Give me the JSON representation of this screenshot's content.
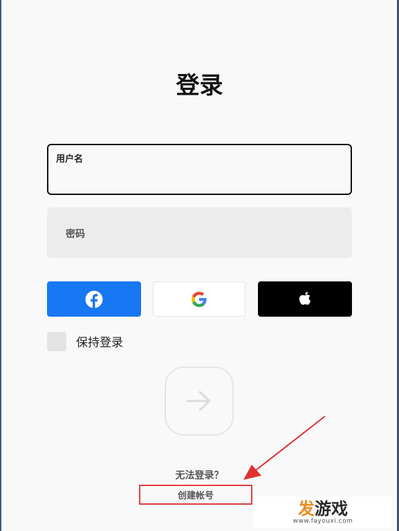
{
  "login": {
    "title": "登录",
    "username_label": "用户名",
    "username_value": "",
    "password_label": "密码",
    "social": [
      {
        "name": "facebook",
        "icon": "facebook-icon",
        "color": "#1877f2"
      },
      {
        "name": "google",
        "icon": "google-icon",
        "color": "#ffffff"
      },
      {
        "name": "apple",
        "icon": "apple-icon",
        "color": "#000000"
      }
    ],
    "remember_label": "保持登录",
    "remember_checked": false,
    "submit_icon": "arrow-right-icon",
    "cant_sign_in": "无法登录？",
    "create_account": "创建帐号"
  },
  "annotation": {
    "highlight_color": "#e04040",
    "arrow_color": "#e03030"
  },
  "watermark": {
    "brand_char1": "发",
    "brand_rest": "游戏",
    "url": "www.fayouxi.com"
  }
}
